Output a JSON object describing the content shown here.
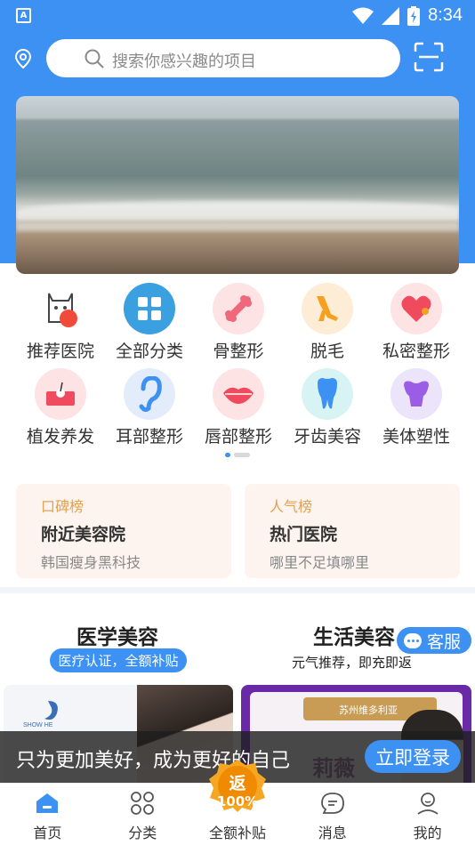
{
  "colors": {
    "primary": "#3d91f2",
    "rank_tag": "#e5a04e",
    "card_bg": "#fdf4ef"
  },
  "status_bar": {
    "time": "8:34",
    "app_icon_letter": "A"
  },
  "search": {
    "placeholder": "搜索你感兴趣的项目"
  },
  "categories": [
    {
      "label": "推荐医院",
      "icon": "lucky-cat-icon"
    },
    {
      "label": "全部分类",
      "icon": "grid-icon"
    },
    {
      "label": "骨整形",
      "icon": "bone-icon"
    },
    {
      "label": "脱毛",
      "icon": "legs-icon"
    },
    {
      "label": "私密整形",
      "icon": "heart-icon"
    },
    {
      "label": "植发养发",
      "icon": "hair-follicle-icon"
    },
    {
      "label": "耳部整形",
      "icon": "ear-icon"
    },
    {
      "label": "唇部整形",
      "icon": "lips-icon"
    },
    {
      "label": "牙齿美容",
      "icon": "tooth-icon"
    },
    {
      "label": "美体塑性",
      "icon": "body-icon"
    }
  ],
  "pager": {
    "current": 1,
    "total": 2
  },
  "rank_cards": [
    {
      "tag": "口碑榜",
      "title": "附近美容院",
      "subtitle": "韩国瘦身黑科技"
    },
    {
      "tag": "人气榜",
      "title": "热门医院",
      "subtitle": "哪里不足填哪里"
    }
  ],
  "sections": {
    "medical": {
      "title": "医学美容",
      "pill": "医疗认证，全额补贴"
    },
    "life": {
      "title": "生活美容",
      "subtitle": "元气推荐，即充即返"
    }
  },
  "service": {
    "label": "客服"
  },
  "product_cards": {
    "left_logo_text": "SHOW HE",
    "right_ribbon_text": "苏州维多利亚",
    "right_brand_text": "莉薇"
  },
  "login_bar": {
    "text": "只为更加美好，成为更好的自己",
    "button": "立即登录"
  },
  "rebate_badge": {
    "line1": "返",
    "line2": "100%"
  },
  "bottom_nav": [
    {
      "label": "首页",
      "icon": "home-icon"
    },
    {
      "label": "分类",
      "icon": "category-icon"
    },
    {
      "label": "全额补贴",
      "icon": "rebate-icon"
    },
    {
      "label": "消息",
      "icon": "message-icon"
    },
    {
      "label": "我的",
      "icon": "profile-icon"
    }
  ]
}
